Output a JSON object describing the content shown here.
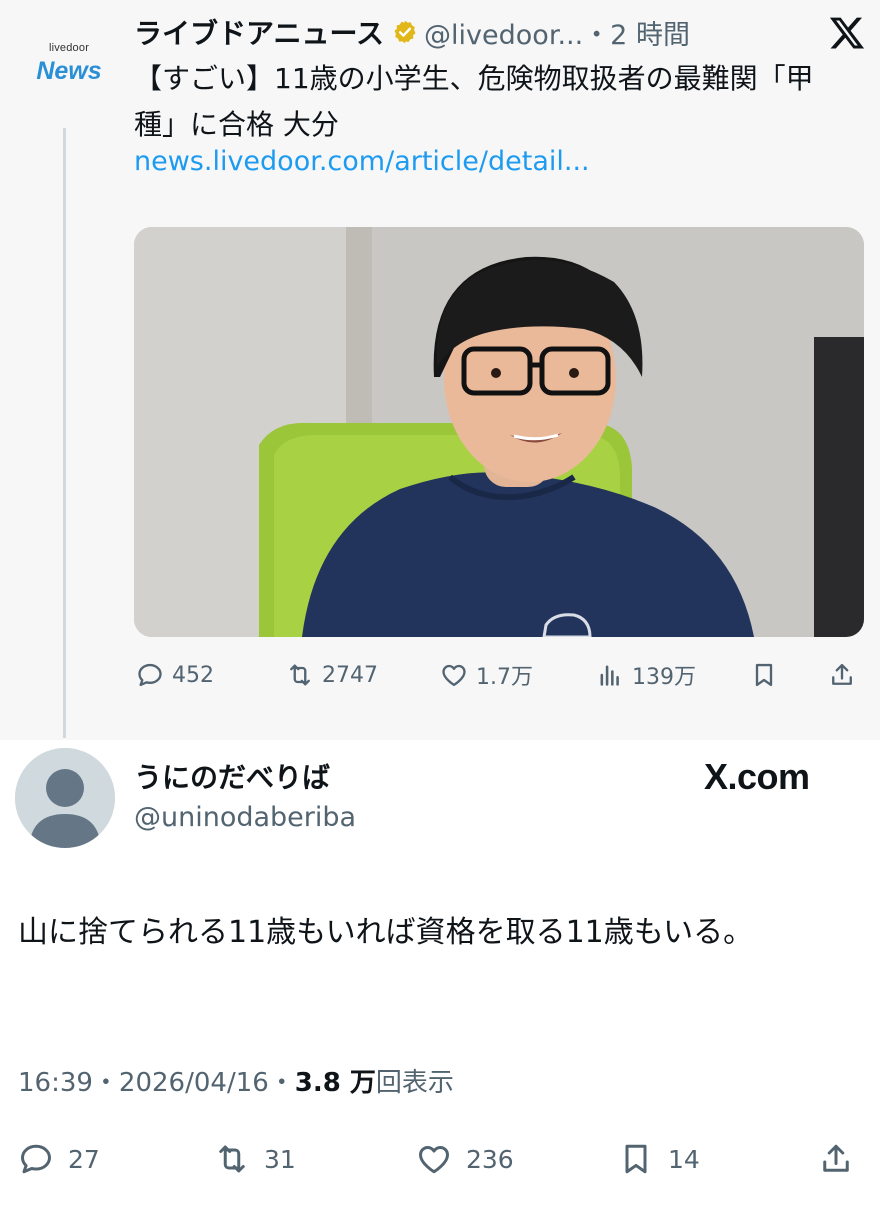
{
  "quoted": {
    "logo_small": "livedoor",
    "logo_big": "News",
    "name": "ライブドアニュース",
    "handle_time": "@livedoor...・2 時間",
    "text": "【すごい】11歳の小学生、危険物取扱者の最難関「甲種」に合格 大分",
    "link": "news.livedoor.com/article/detail...",
    "actions": {
      "reply": "452",
      "retweet": "2747",
      "like": "1.7万",
      "views": "139万"
    }
  },
  "reply": {
    "name": "うにのだべりば",
    "handle": "@uninodaberiba",
    "source": "X.com",
    "text": "山に捨てられる11歳もいれば資格を取る11歳もいる。",
    "meta": {
      "timestamp": "16:39・2026/04/16・",
      "views_count": "3.8 万",
      "views_label": "回表示"
    },
    "actions": {
      "reply": "27",
      "retweet": "31",
      "like": "236",
      "bookmark": "14"
    }
  },
  "colors": {
    "accent_link": "#1d9bf0",
    "verified_gold": "#e2b719",
    "muted_text": "#536471",
    "quoted_bg": "#f7f7f8",
    "logo_blue": "#2b8fd6"
  },
  "icons": [
    "verified-badge-icon",
    "x-logo-icon",
    "reply-icon",
    "retweet-icon",
    "like-icon",
    "views-icon",
    "bookmark-icon",
    "share-icon",
    "default-avatar-icon"
  ]
}
